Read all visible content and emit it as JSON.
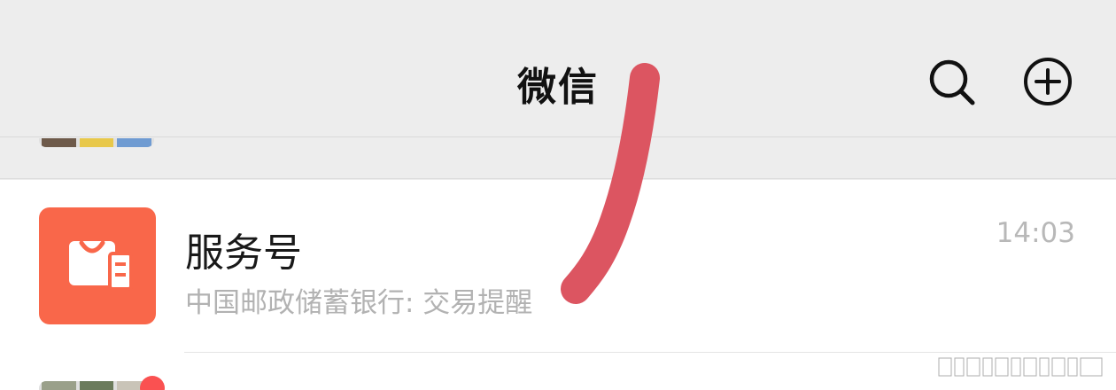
{
  "header": {
    "title": "微信",
    "search_icon": "search-icon",
    "add_icon": "add-circle-icon"
  },
  "chat": {
    "name": "服务号",
    "preview": "中国邮政储蓄银行: 交易提醒",
    "time": "14:03",
    "avatar_icon": "service-account-bag-icon",
    "avatar_color": "#f9674a"
  },
  "next_row": {
    "unread_badge_color": "#fa5151"
  },
  "annotation": {
    "color": "#dc5561"
  },
  "watermark": {
    "icon": "watermark-bars-icon"
  }
}
